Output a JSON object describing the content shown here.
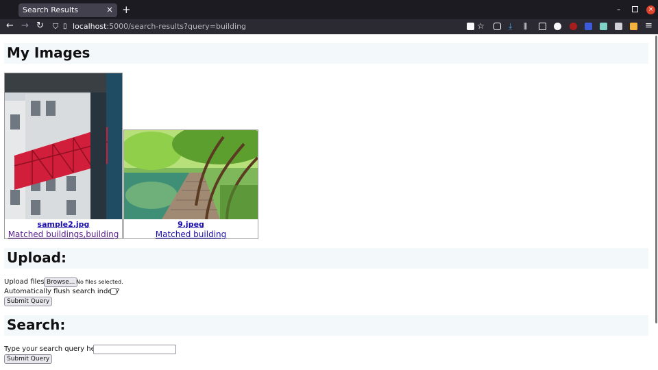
{
  "browser": {
    "tab_title": "Search Results",
    "tab_close": "×",
    "new_tab": "+",
    "url_host": "localhost",
    "url_path": ":5000/search-results?query=building",
    "win_min": "–",
    "win_close": "×"
  },
  "page": {
    "images_heading": "My Images",
    "images": [
      {
        "filename": "sample2.jpg",
        "match": "Matched buildings,building"
      },
      {
        "filename": "9.jpeg",
        "match": "Matched building"
      }
    ],
    "upload": {
      "heading": "Upload:",
      "files_label": "Upload files:",
      "browse_label": "Browse...",
      "no_files": "No files selected.",
      "flush_label": "Automatically flush search index?",
      "submit_label": "Submit Query"
    },
    "search": {
      "heading": "Search:",
      "query_label": "Type your search query here",
      "query_value": "",
      "submit_label": "Submit Query"
    }
  }
}
